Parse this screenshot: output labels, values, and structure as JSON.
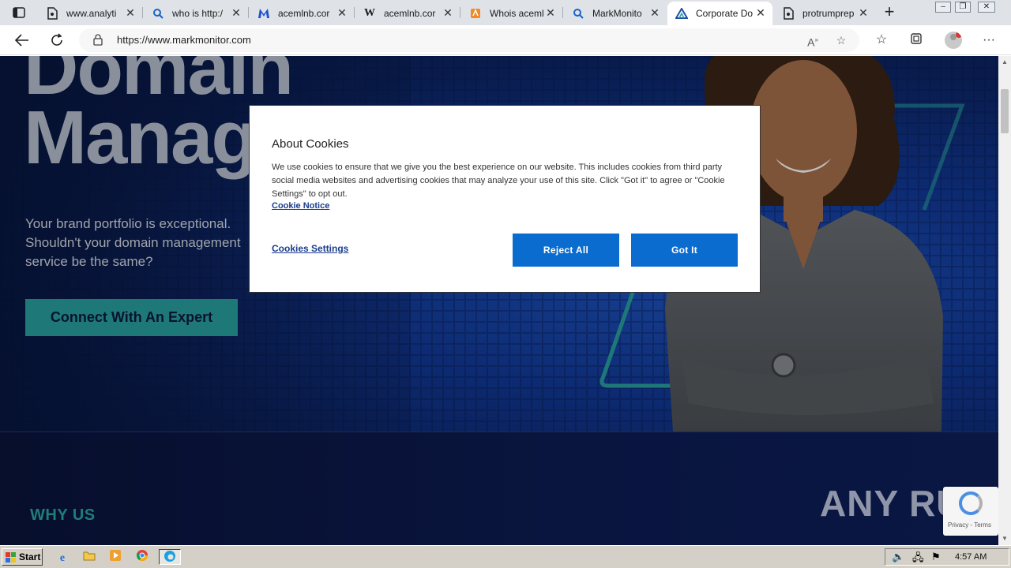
{
  "browser": {
    "tabs": [
      {
        "label": "www.analyti",
        "icon": "document-icon"
      },
      {
        "label": "who is http:/",
        "icon": "search-icon"
      },
      {
        "label": "acemlnb.cor",
        "icon": "malwarebytes-icon"
      },
      {
        "label": "acemlnb.cor",
        "icon": "wikipedia-icon"
      },
      {
        "label": "Whois aceml",
        "icon": "whois-icon"
      },
      {
        "label": "MarkMonito",
        "icon": "search-icon"
      },
      {
        "label": "Corporate Do",
        "icon": "markmonitor-icon",
        "active": true
      },
      {
        "label": "protrumprep",
        "icon": "document-icon"
      }
    ],
    "url": "https://www.markmonitor.com",
    "window_controls": [
      "minimize",
      "restore",
      "close"
    ]
  },
  "page": {
    "hero_title_line1": "Domain",
    "hero_title_line2": "Manag",
    "hero_subtitle": "Your brand portfolio is exceptional. Shouldn't your domain management service be the same?",
    "cta_label": "Connect With An Expert",
    "section_heading": "WHY US",
    "recaptcha_text": "Privacy - Terms"
  },
  "cookie_dialog": {
    "title": "About Cookies",
    "body": "We use cookies to ensure that we give you the best experience on our website. This includes cookies from third party social media websites and advertising cookies that may analyze your use of this site. Click \"Got it\" to agree or \"Cookie Settings\" to opt out.",
    "notice_link": "Cookie Notice",
    "settings_link": "Cookies Settings",
    "reject_label": "Reject All",
    "accept_label": "Got It"
  },
  "watermark": "ANY RUN",
  "taskbar": {
    "start_label": "Start",
    "clock": "4:57 AM"
  },
  "colors": {
    "accent_teal": "#2aa0a0",
    "button_blue": "#0a6ccf",
    "link_blue": "#1a3d8f"
  }
}
